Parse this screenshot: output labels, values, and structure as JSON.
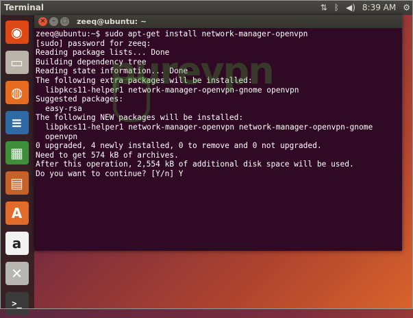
{
  "panel": {
    "app_title": "Terminal",
    "time": "8:39 AM",
    "icons": [
      "network-icon",
      "bluetooth-icon",
      "volume-icon",
      "settings-gear-icon"
    ]
  },
  "launcher": {
    "items": [
      {
        "name": "ubuntu-dash-icon",
        "glyph": "◉",
        "bg": "#dd4814"
      },
      {
        "name": "files-icon",
        "glyph": "▭",
        "bg": "#b9b3a9"
      },
      {
        "name": "firefox-icon",
        "glyph": "◍",
        "bg": "#e66d1f"
      },
      {
        "name": "writer-icon",
        "glyph": "≡",
        "bg": "#2d6aa6"
      },
      {
        "name": "calc-icon",
        "glyph": "▦",
        "bg": "#3f8f3a"
      },
      {
        "name": "impress-icon",
        "glyph": "▤",
        "bg": "#c6612a"
      },
      {
        "name": "software-center-icon",
        "glyph": "A",
        "bg": "#e06b2a"
      },
      {
        "name": "amazon-icon",
        "glyph": "a",
        "bg": "#f2f2f2"
      },
      {
        "name": "system-settings-icon",
        "glyph": "✕",
        "bg": "#b8b6b0"
      },
      {
        "name": "terminal-icon",
        "glyph": ">_",
        "bg": "#3a3a3a"
      }
    ]
  },
  "window": {
    "title": "zeeq@ubuntu: ~",
    "buttons": {
      "close": "×",
      "minimize": "–",
      "maximize": "□"
    }
  },
  "watermark": "purevpn",
  "terminal": {
    "lines": [
      {
        "text": "zeeq@ubuntu:~$ sudo apt-get install network-manager-openvpn",
        "indent": false
      },
      {
        "text": "[sudo] password for zeeq:",
        "indent": false
      },
      {
        "text": "Reading package lists... Done",
        "indent": false
      },
      {
        "text": "Building dependency tree",
        "indent": false
      },
      {
        "text": "Reading state information... Done",
        "indent": false
      },
      {
        "text": "The following extra packages will be installed:",
        "indent": false
      },
      {
        "text": "libpkcs11-helper1 network-manager-openvpn-gnome openvpn",
        "indent": true
      },
      {
        "text": "Suggested packages:",
        "indent": false
      },
      {
        "text": "easy-rsa",
        "indent": true
      },
      {
        "text": "The following NEW packages will be installed:",
        "indent": false
      },
      {
        "text": "libpkcs11-helper1 network-manager-openvpn network-manager-openvpn-gnome",
        "indent": true
      },
      {
        "text": "openvpn",
        "indent": true
      },
      {
        "text": "0 upgraded, 4 newly installed, 0 to remove and 0 not upgraded.",
        "indent": false
      },
      {
        "text": "Need to get 574 kB of archives.",
        "indent": false
      },
      {
        "text": "After this operation, 2,554 kB of additional disk space will be used.",
        "indent": false
      },
      {
        "text": "Do you want to continue? [Y/n] Y",
        "indent": false
      }
    ]
  }
}
